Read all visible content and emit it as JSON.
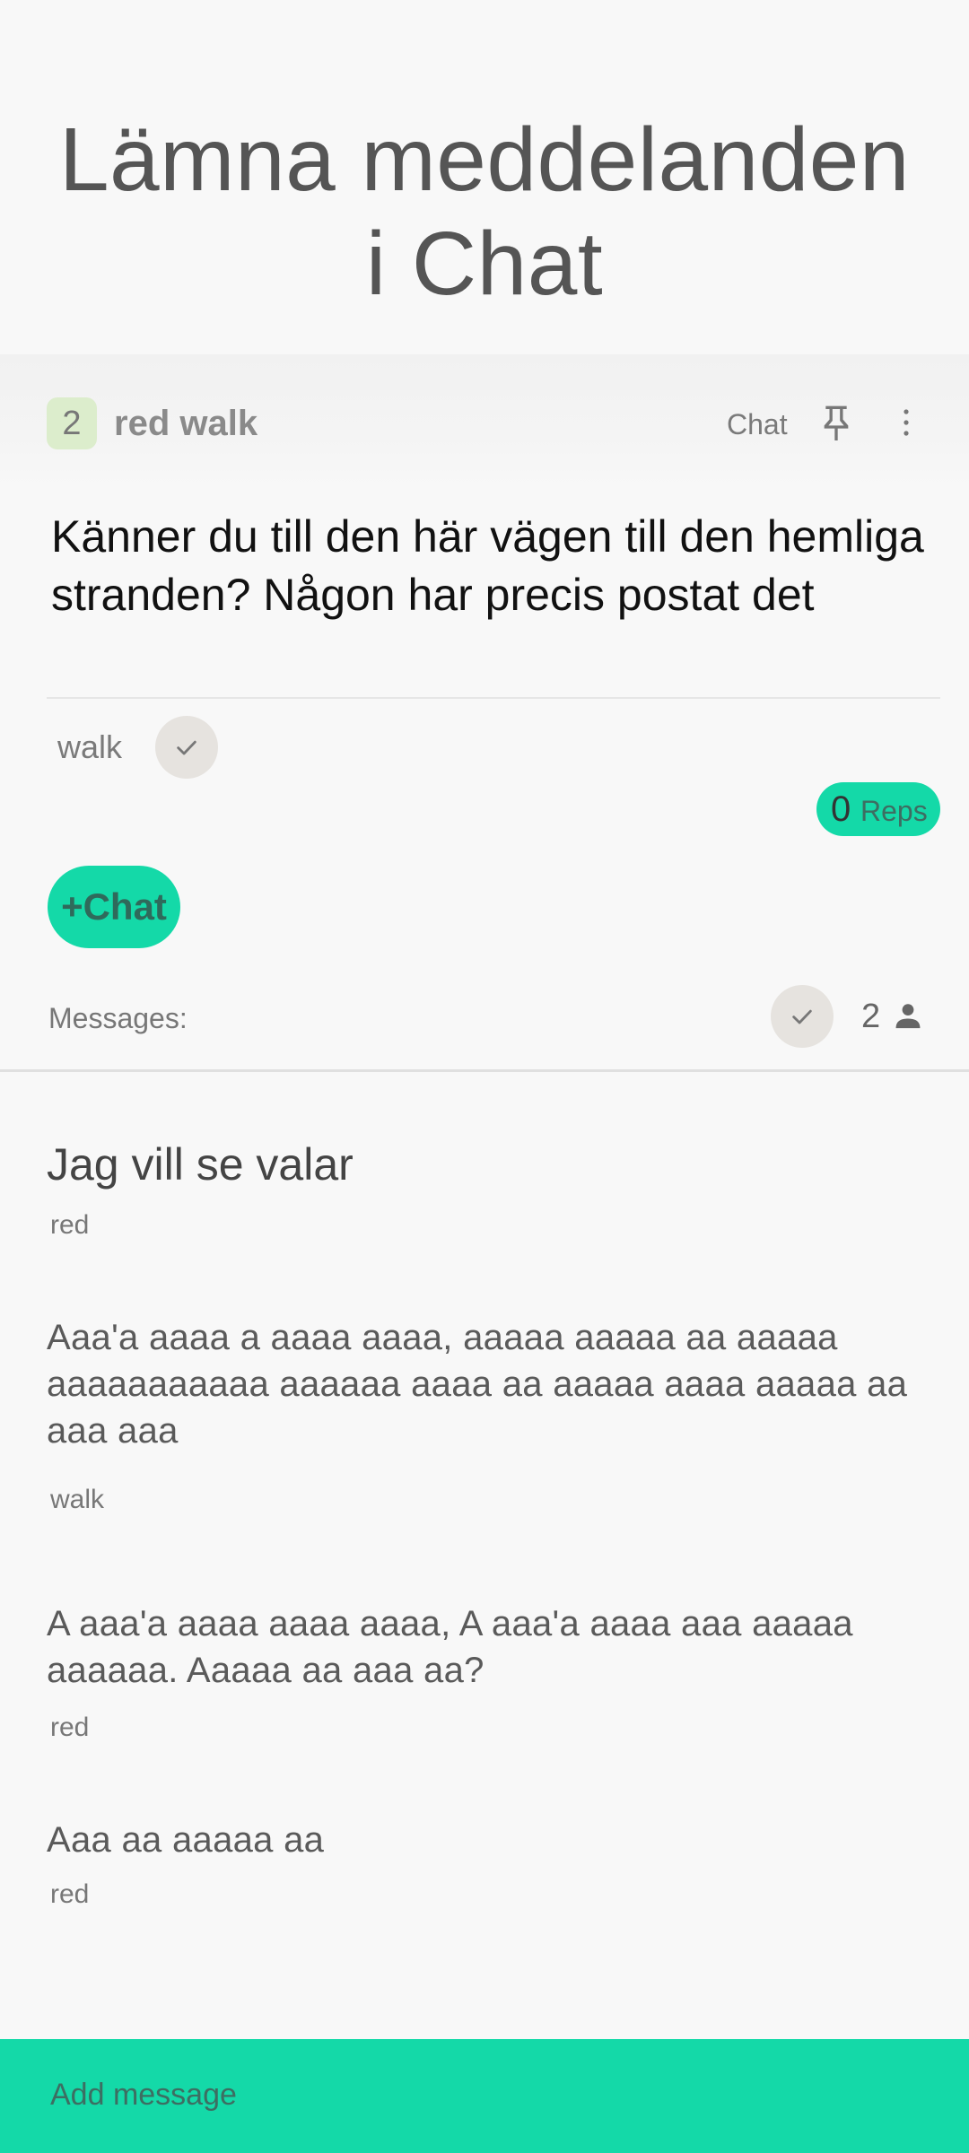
{
  "overlay": {
    "title_line1": "Lämna meddelanden",
    "title_line2": "i Chat"
  },
  "header": {
    "count": "2",
    "group_name": "red walk",
    "chat_label": "Chat",
    "pin_icon": "pin-icon",
    "more_icon": "more-vertical-icon"
  },
  "post": {
    "title": "Känner du till den här vägen till den hemliga stranden? Någon har precis postat det",
    "tag": "walk",
    "reps_count": "0",
    "reps_label": "Reps",
    "chat_button": "+Chat"
  },
  "messages_header": {
    "label": "Messages:",
    "participants": "2",
    "person_icon": "person-icon"
  },
  "messages": [
    {
      "text": "Jag vill se valar",
      "author": "red"
    },
    {
      "text": "Aaa'a aaaa a aaaa aaaa, aaaaa aaaaa aa aaaaa aaaaaaaaaaa aaaaaa aaaa aa aaaaa aaaa aaaaa aa aaa aaa",
      "author": "walk"
    },
    {
      "text": "A aaa'a aaaa aaaa aaaa, A aaa'a aaaa aaa aaaaa aaaaaa. Aaaaa aa aaa aa?",
      "author": "red"
    },
    {
      "text": "Aaa aa aaaaa aa",
      "author": "red"
    }
  ],
  "composer": {
    "placeholder": "Add message"
  },
  "colors": {
    "accent": "#14d9a8",
    "badge": "#dcedcc",
    "background": "#f8f8f8"
  }
}
